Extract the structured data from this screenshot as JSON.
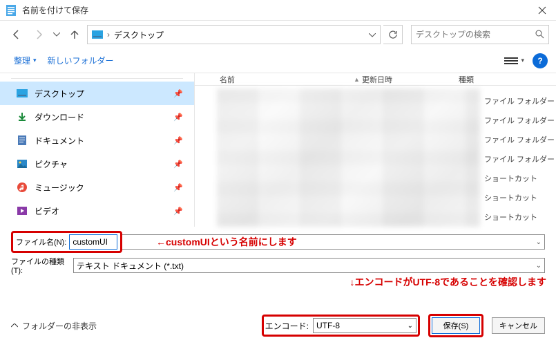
{
  "window": {
    "title": "名前を付けて保存"
  },
  "address": {
    "crumb": "デスクトップ",
    "search_placeholder": "デスクトップの検索"
  },
  "toolbar": {
    "organize": "整理",
    "newfolder": "新しいフォルダー"
  },
  "sidebar": {
    "items": [
      {
        "label": "デスクトップ",
        "icon": "desktop"
      },
      {
        "label": "ダウンロード",
        "icon": "download"
      },
      {
        "label": "ドキュメント",
        "icon": "document"
      },
      {
        "label": "ピクチャ",
        "icon": "pictures"
      },
      {
        "label": "ミュージック",
        "icon": "music"
      },
      {
        "label": "ビデオ",
        "icon": "video"
      }
    ]
  },
  "headers": {
    "name": "名前",
    "date": "更新日時",
    "type": "種類"
  },
  "types": [
    "ファイル フォルダー",
    "ファイル フォルダー",
    "ファイル フォルダー",
    "ファイル フォルダー",
    "ショートカット",
    "ショートカット",
    "ショートカット"
  ],
  "filename": {
    "label": "ファイル名(N):",
    "value": "customUI"
  },
  "filetype": {
    "label": "ファイルの種類(T):",
    "value": "テキスト ドキュメント (*.txt)"
  },
  "encode": {
    "label": "エンコード:",
    "value": "UTF-8"
  },
  "buttons": {
    "save": "保存(S)",
    "cancel": "キャンセル",
    "folders": "フォルダーの非表示"
  },
  "annot": {
    "filename": "←customUIという名前にします",
    "encode": "↓エンコードがUTF-8であることを確認します"
  }
}
